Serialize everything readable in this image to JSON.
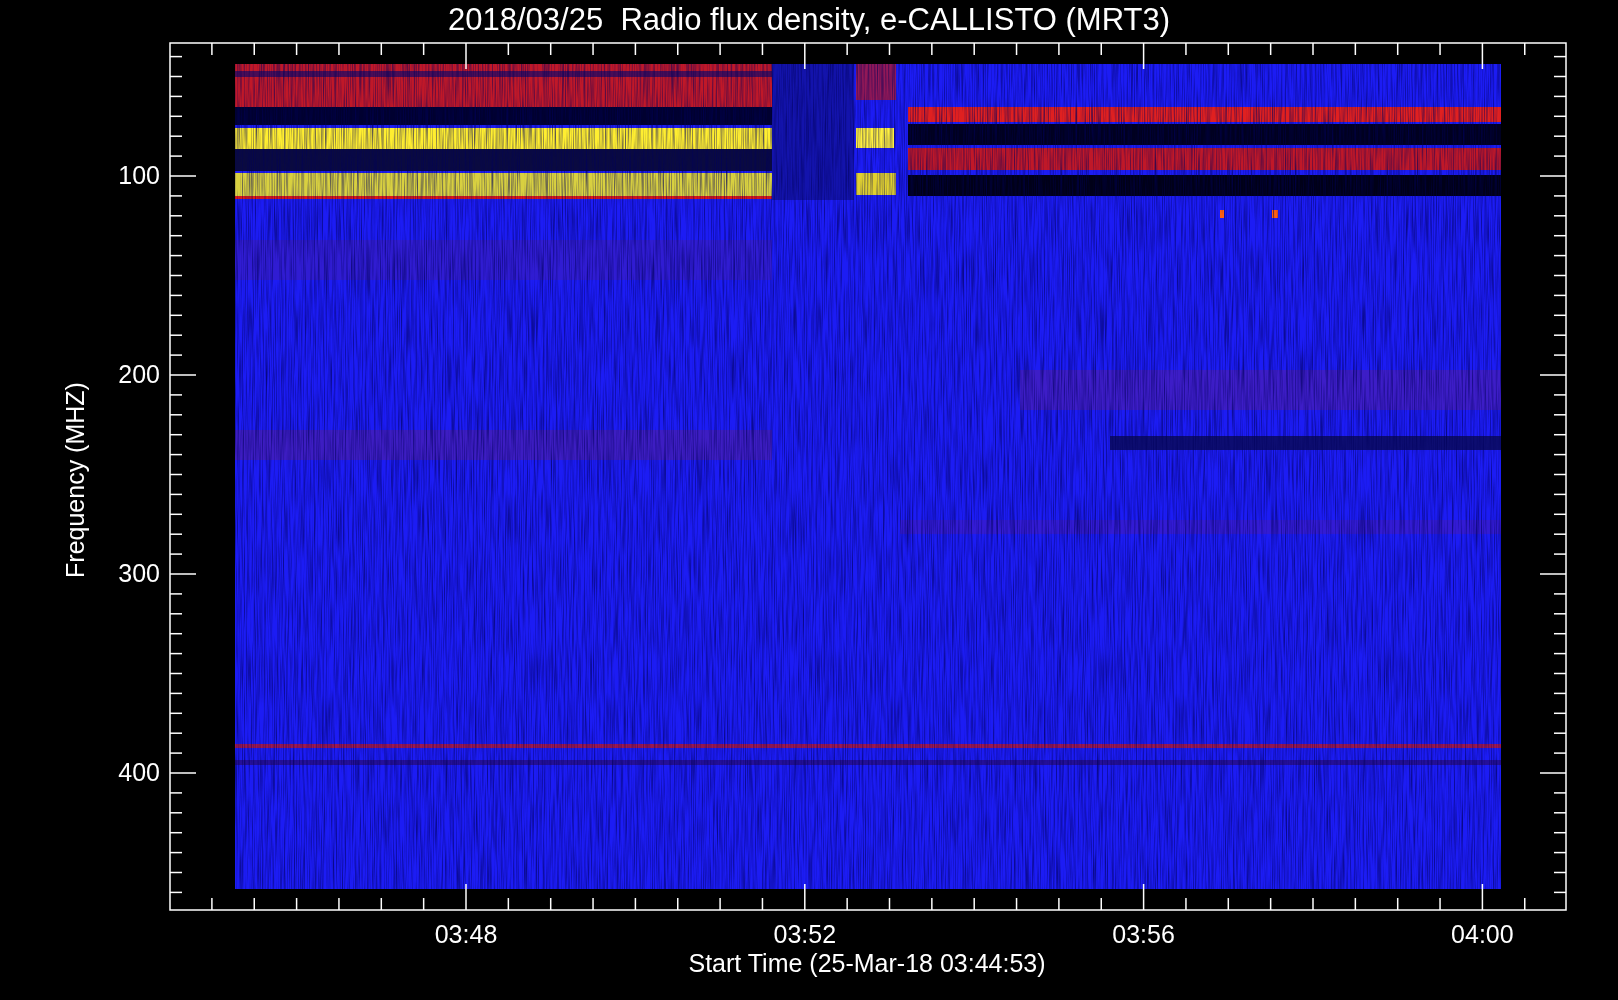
{
  "title": "2018/03/25  Radio flux density, e-CALLISTO (MRT3)",
  "y_axis": {
    "label": "Frequency (MHZ)",
    "ticks": [
      "100",
      "200",
      "300",
      "400"
    ]
  },
  "x_axis": {
    "label": "Start Time (25-Mar-18 03:44:53)",
    "ticks": [
      "03:48",
      "03:52",
      "03:56",
      "04:00"
    ]
  }
}
